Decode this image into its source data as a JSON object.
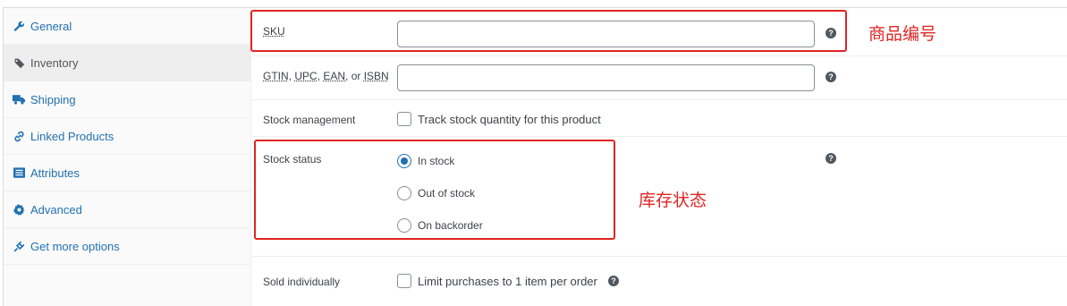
{
  "tabs": [
    {
      "label": "General",
      "icon": "wrench-icon",
      "active": false
    },
    {
      "label": "Inventory",
      "icon": "tag-icon",
      "active": true
    },
    {
      "label": "Shipping",
      "icon": "truck-icon",
      "active": false
    },
    {
      "label": "Linked Products",
      "icon": "link-icon",
      "active": false
    },
    {
      "label": "Attributes",
      "icon": "list-icon",
      "active": false
    },
    {
      "label": "Advanced",
      "icon": "gear-icon",
      "active": false
    },
    {
      "label": "Get more options",
      "icon": "plug-icon",
      "active": false
    }
  ],
  "fields": {
    "sku": {
      "label": "SKU",
      "value": ""
    },
    "gtin": {
      "label_parts": [
        "GTIN",
        "UPC",
        "EAN",
        "ISBN"
      ],
      "sep1": ", ",
      "sep2": ", ",
      "sep3": ", or ",
      "value": ""
    },
    "stock_management": {
      "label": "Stock management",
      "checkbox_label": "Track stock quantity for this product",
      "checked": false
    },
    "stock_status": {
      "label": "Stock status",
      "options": [
        {
          "label": "In stock",
          "selected": true
        },
        {
          "label": "Out of stock",
          "selected": false
        },
        {
          "label": "On backorder",
          "selected": false
        }
      ]
    },
    "sold_individually": {
      "label": "Sold individually",
      "checkbox_label": "Limit purchases to 1 item per order",
      "checked": false
    }
  },
  "help_glyph": "?",
  "annotations": {
    "sku_note": "商品编号",
    "stock_note": "库存状态"
  },
  "colors": {
    "link": "#2271b1",
    "annotation": "#e02424"
  }
}
